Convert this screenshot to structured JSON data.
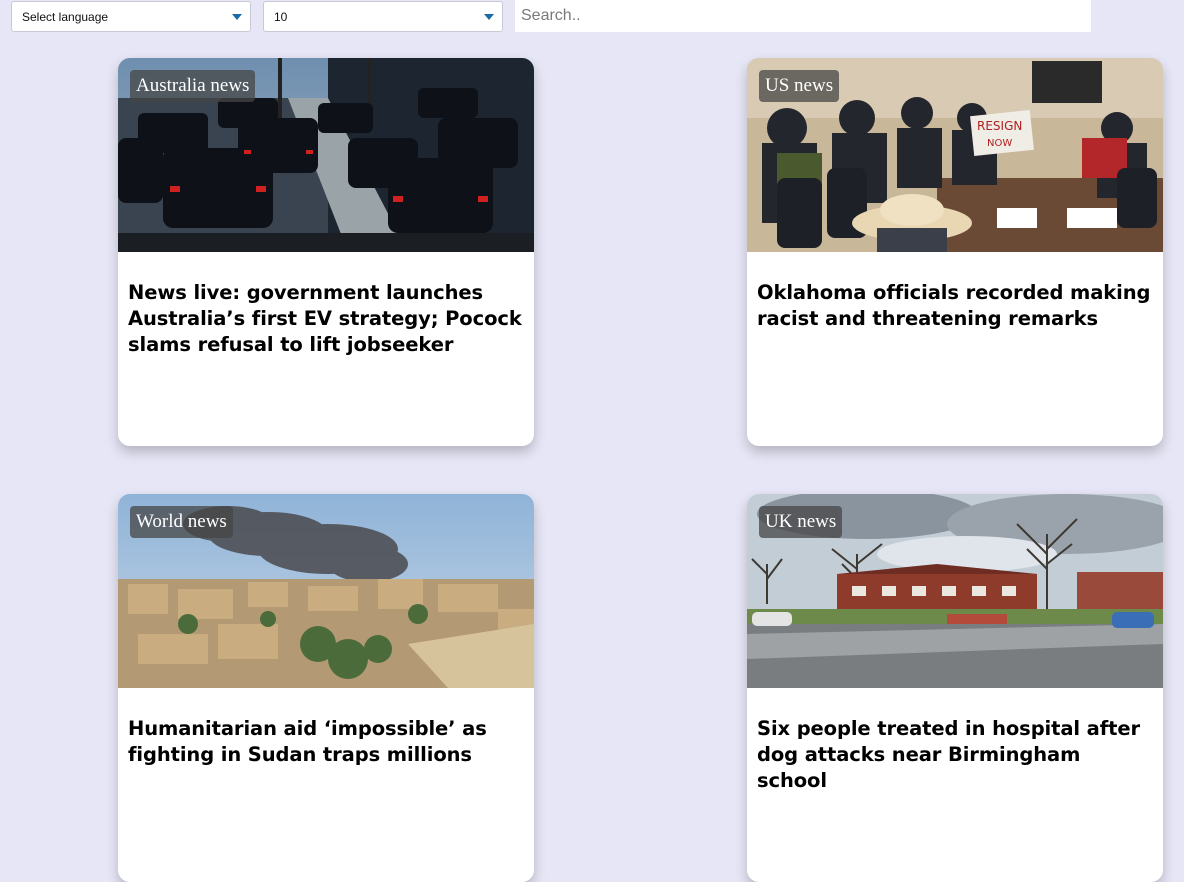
{
  "controls": {
    "language_select": "Select language",
    "count_select": "10",
    "search_placeholder": "Search.."
  },
  "articles": [
    {
      "category": "Australia news",
      "headline": "News live: government launches Australia’s first EV strategy; Pocock slams refusal to lift jobseeker",
      "image": "traffic-jam-photo"
    },
    {
      "category": "US news",
      "headline": "Oklahoma officials recorded making racist and threatening remarks",
      "image": "protest-meeting-photo"
    },
    {
      "category": "World news",
      "headline": "Humanitarian aid ‘impossible’ as fighting in Sudan traps millions",
      "image": "city-smoke-photo"
    },
    {
      "category": "UK news",
      "headline": "Six people treated in hospital after dog attacks near Birmingham school",
      "image": "residential-street-photo"
    }
  ]
}
